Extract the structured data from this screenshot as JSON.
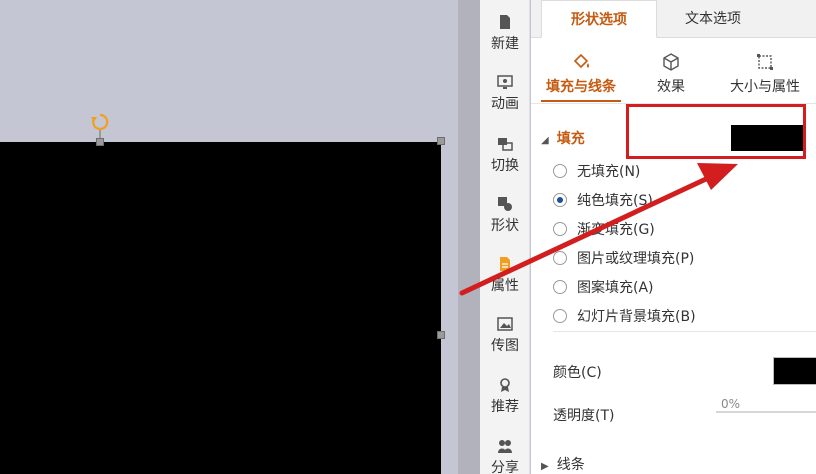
{
  "taskbar": {
    "items": [
      {
        "label": "新建",
        "icon": "new-file-icon"
      },
      {
        "label": "动画",
        "icon": "animation-icon"
      },
      {
        "label": "切换",
        "icon": "transition-icon"
      },
      {
        "label": "形状",
        "icon": "shape-icon"
      },
      {
        "label": "属性",
        "icon": "property-icon"
      },
      {
        "label": "传图",
        "icon": "upload-image-icon"
      },
      {
        "label": "推荐",
        "icon": "recommend-icon"
      },
      {
        "label": "分享",
        "icon": "share-icon"
      }
    ],
    "active_index": 4
  },
  "panel": {
    "tabs": [
      {
        "label": "形状选项",
        "active": true
      },
      {
        "label": "文本选项",
        "active": false
      }
    ],
    "subtabs": [
      {
        "label": "填充与线条",
        "icon": "fill-bucket-icon",
        "active": true
      },
      {
        "label": "效果",
        "icon": "cube-effect-icon",
        "active": false
      },
      {
        "label": "大小与属性",
        "icon": "size-frame-icon",
        "active": false
      }
    ],
    "fill_section": {
      "title": "填充",
      "swatch_color": "#000000",
      "options": [
        {
          "label": "无填充(N)",
          "checked": false
        },
        {
          "label": "纯色填充(S)",
          "checked": true
        },
        {
          "label": "渐变填充(G)",
          "checked": false
        },
        {
          "label": "图片或纹理填充(P)",
          "checked": false
        },
        {
          "label": "图案填充(A)",
          "checked": false
        },
        {
          "label": "幻灯片背景填充(B)",
          "checked": false
        }
      ],
      "color_label": "颜色(C)",
      "color_value": "#000000",
      "transparency_label": "透明度(T)",
      "transparency_value": "0%"
    },
    "line_section": {
      "title": "线条"
    }
  },
  "colors": {
    "accent": "#c55a11",
    "annotation": "#d21e1e",
    "canvas_bg": "#c5c6d3",
    "shape_fill": "#000000"
  }
}
